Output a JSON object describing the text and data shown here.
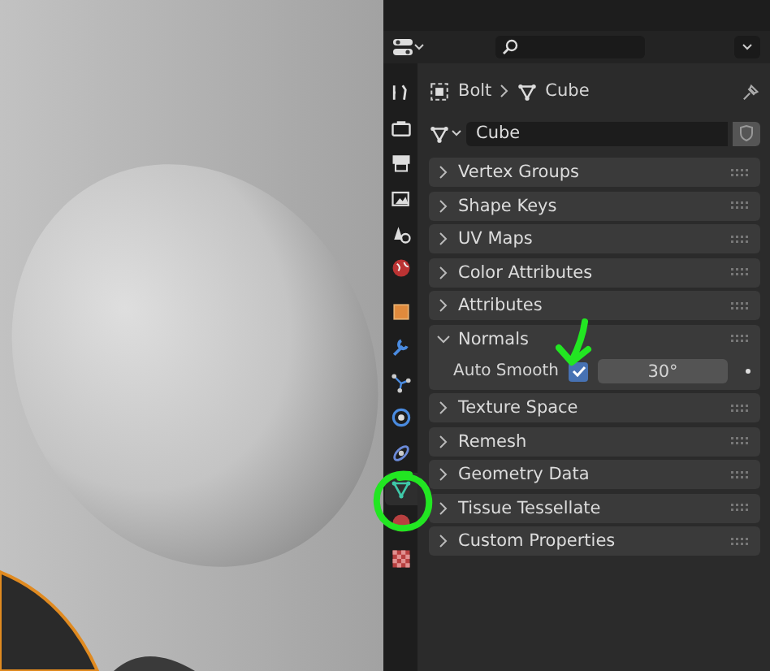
{
  "tabs": [
    {
      "kind": "tool",
      "selected": false
    },
    {
      "kind": "render",
      "selected": false
    },
    {
      "kind": "output",
      "selected": false
    },
    {
      "kind": "view-layer",
      "selected": false
    },
    {
      "kind": "scene",
      "selected": false
    },
    {
      "kind": "world",
      "selected": false
    },
    {
      "kind": "object",
      "selected": false
    },
    {
      "kind": "modifier",
      "selected": false
    },
    {
      "kind": "particles",
      "selected": false
    },
    {
      "kind": "physics",
      "selected": false
    },
    {
      "kind": "constraints",
      "selected": false
    },
    {
      "kind": "data",
      "selected": true
    },
    {
      "kind": "material",
      "selected": false
    },
    {
      "kind": "texture",
      "selected": false
    }
  ],
  "breadcrumb": [
    {
      "kind": "object",
      "label": "Bolt"
    },
    {
      "kind": "mesh",
      "label": "Cube"
    }
  ],
  "datablock": {
    "value": "Cube"
  },
  "panels": [
    {
      "title": "Vertex Groups",
      "expanded": false
    },
    {
      "title": "Shape Keys",
      "expanded": false
    },
    {
      "title": "UV Maps",
      "expanded": false
    },
    {
      "title": "Color Attributes",
      "expanded": false
    },
    {
      "title": "Attributes",
      "expanded": false
    },
    {
      "title": "Normals",
      "expanded": true,
      "fields": [
        {
          "label": "Auto Smooth",
          "checked": true,
          "value": "30°"
        }
      ]
    },
    {
      "title": "Texture Space",
      "expanded": false
    },
    {
      "title": "Remesh",
      "expanded": false
    },
    {
      "title": "Geometry Data",
      "expanded": false
    },
    {
      "title": "Tissue Tessellate",
      "expanded": false
    },
    {
      "title": "Custom Properties",
      "expanded": false
    }
  ]
}
